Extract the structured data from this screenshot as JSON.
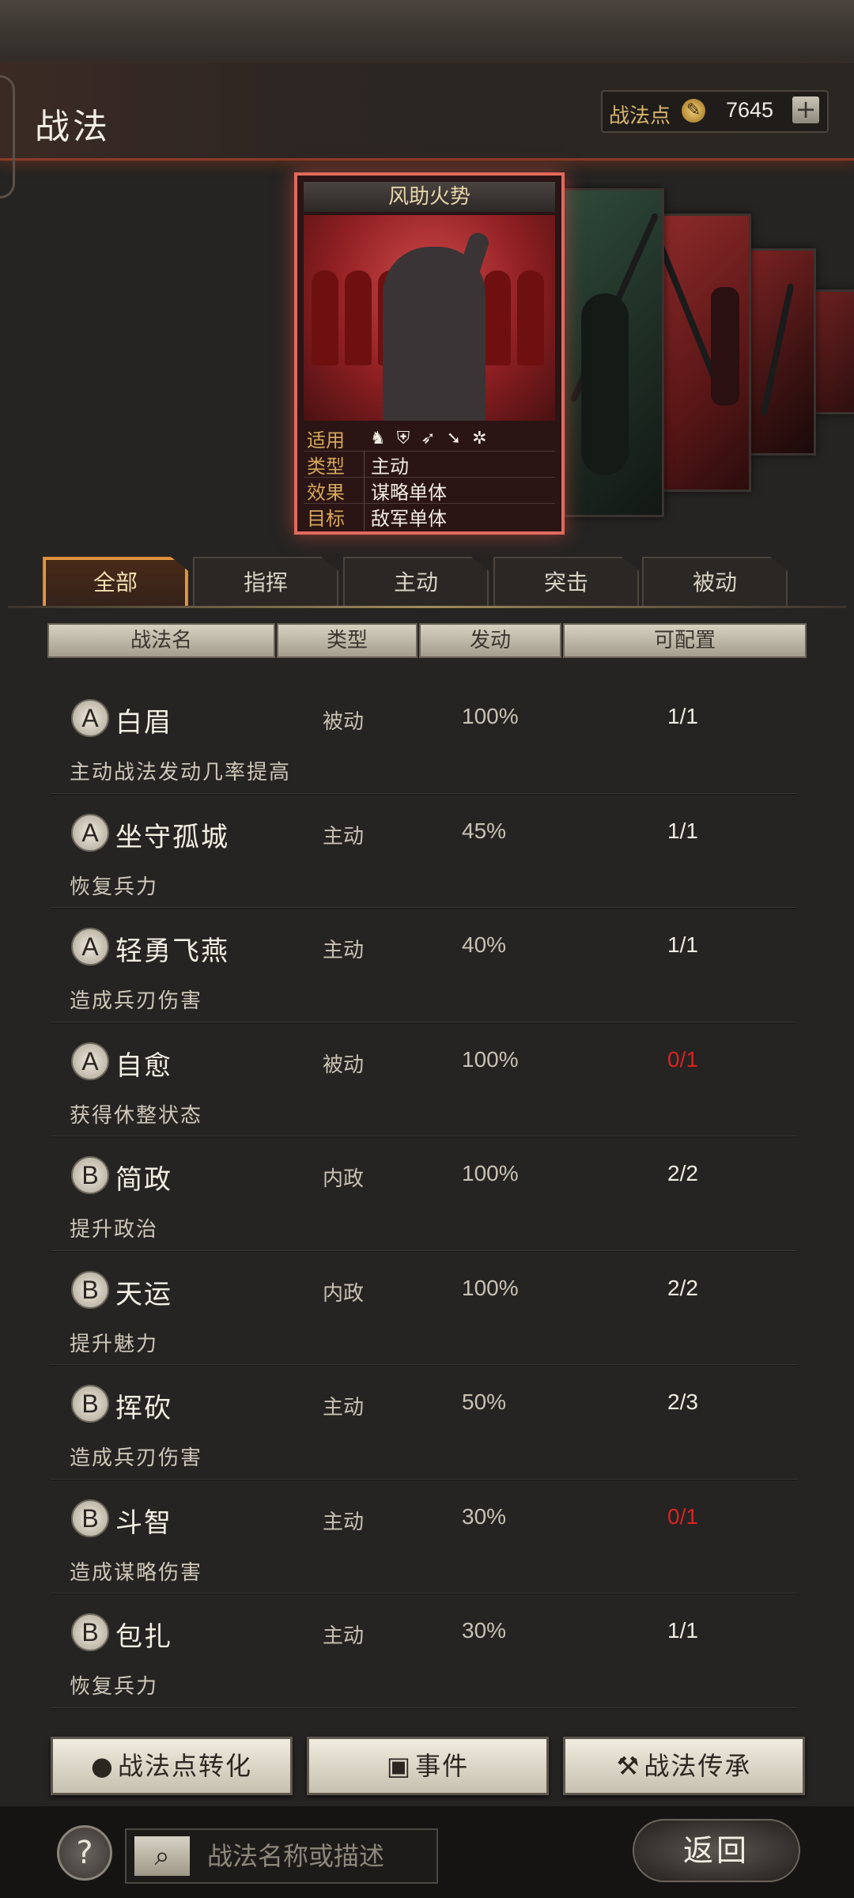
{
  "header": {
    "title": "战法",
    "points_label": "战法点",
    "points_value": "7645",
    "points_add": "+"
  },
  "card": {
    "title": "风助火势",
    "rows": [
      {
        "key": "适用",
        "value": ""
      },
      {
        "key": "类型",
        "value": "主动"
      },
      {
        "key": "效果",
        "value": "谋略单体"
      },
      {
        "key": "目标",
        "value": "敌军单体"
      }
    ],
    "unit_icons": [
      "cavalry-icon",
      "shield-icon",
      "bow-icon",
      "spear-icon",
      "wheel-icon"
    ]
  },
  "tabs": [
    "全部",
    "指挥",
    "主动",
    "突击",
    "被动"
  ],
  "columns": [
    "战法名",
    "类型",
    "发动",
    "可配置"
  ],
  "tactics": [
    {
      "grade": "A",
      "name": "白眉",
      "type": "被动",
      "rate": "100%",
      "cap": "1/1",
      "desc": "主动战法发动几率提高"
    },
    {
      "grade": "A",
      "name": "坐守孤城",
      "type": "主动",
      "rate": "45%",
      "cap": "1/1",
      "desc": "恢复兵力"
    },
    {
      "grade": "A",
      "name": "轻勇飞燕",
      "type": "主动",
      "rate": "40%",
      "cap": "1/1",
      "desc": "造成兵刃伤害"
    },
    {
      "grade": "A",
      "name": "自愈",
      "type": "被动",
      "rate": "100%",
      "cap": "0/1",
      "desc": "获得休整状态"
    },
    {
      "grade": "B",
      "name": "简政",
      "type": "内政",
      "rate": "100%",
      "cap": "2/2",
      "desc": "提升政治"
    },
    {
      "grade": "B",
      "name": "天运",
      "type": "内政",
      "rate": "100%",
      "cap": "2/2",
      "desc": "提升魅力"
    },
    {
      "grade": "B",
      "name": "挥砍",
      "type": "主动",
      "rate": "50%",
      "cap": "2/3",
      "desc": "造成兵刃伤害"
    },
    {
      "grade": "B",
      "name": "斗智",
      "type": "主动",
      "rate": "30%",
      "cap": "0/1",
      "desc": "造成谋略伤害"
    },
    {
      "grade": "B",
      "name": "包扎",
      "type": "主动",
      "rate": "30%",
      "cap": "1/1",
      "desc": "恢复兵力"
    }
  ],
  "buttons": {
    "convert": "战法点转化",
    "events": "事件",
    "inherit": "战法传承"
  },
  "footer": {
    "help": "?",
    "search_placeholder": "战法名称或描述",
    "back": "返回"
  },
  "colors": {
    "accent": "#e89a42",
    "card_border": "#e06a5e",
    "unavailable": "#d62222"
  }
}
